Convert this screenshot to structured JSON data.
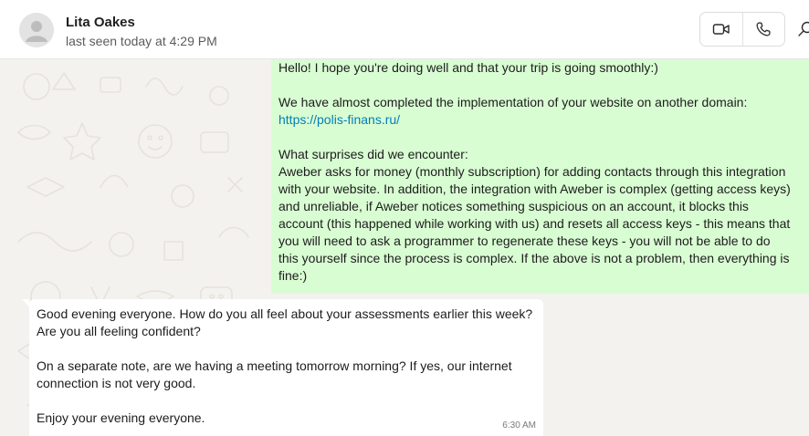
{
  "header": {
    "contact_name": "Lita Oakes",
    "status": "last seen today at 4:29 PM",
    "icons": {
      "avatar": "default-avatar-icon",
      "video": "video-call-icon",
      "voice": "voice-call-icon",
      "search": "search-icon"
    }
  },
  "messages": {
    "outgoing": {
      "lines": {
        "l1": "Hello! I hope you're doing well and that your trip is going smoothly:)",
        "l2": "We have almost completed the implementation of your website on another domain:",
        "link": "https://polis-finans.ru/",
        "l3": "What surprises did we encounter:",
        "l4": "Aweber asks for money (monthly subscription) for adding contacts through this integration",
        "l5": "with your website. In addition, the integration with Aweber is complex (getting access keys)",
        "l6": "and unreliable, if Aweber notices something suspicious on an account, it blocks this",
        "l7": "account (this happened while working with us) and resets all access keys - this means that",
        "l8": "you will need to ask a programmer to regenerate these keys - you will not be able to do",
        "l9": "this yourself since the process is complex. If the above is not a problem, then everything is",
        "l10": "fine:)"
      }
    },
    "incoming": {
      "lines": {
        "l1": "Good evening everyone. How do you all feel about your assessments earlier this week?",
        "l2": "Are you all feeling confident?",
        "l3": "On a separate note, are we having a meeting tomorrow morning? If yes, our internet",
        "l4": "connection is not very good.",
        "l5": "Enjoy your evening everyone."
      },
      "time": "6:30 AM"
    }
  },
  "colors": {
    "outgoing_bubble": "#d9fdd3",
    "incoming_bubble": "#ffffff",
    "chat_background": "#f4f2ef",
    "link": "#027eb5"
  }
}
